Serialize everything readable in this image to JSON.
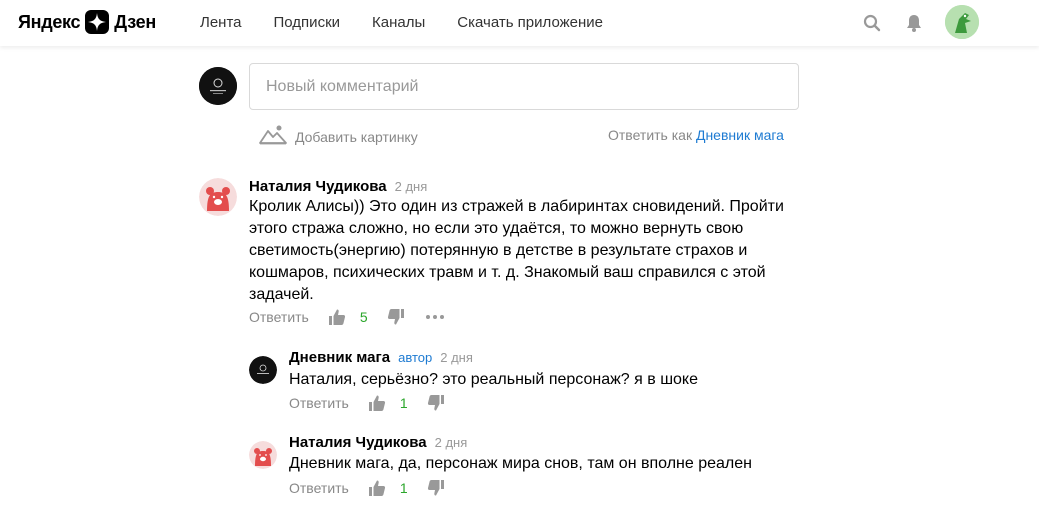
{
  "header": {
    "logo_left": "Яндекс",
    "logo_right": "Дзен",
    "nav": [
      "Лента",
      "Подписки",
      "Каналы",
      "Скачать приложение"
    ],
    "icons": [
      "search-icon",
      "bell-icon",
      "profile-avatar"
    ]
  },
  "composer": {
    "placeholder": "Новый комментарий",
    "add_picture": "Добавить картинку",
    "reply_as_prefix": "Ответить как",
    "reply_as_name": "Дневник мага"
  },
  "comments": [
    {
      "author": "Наталия Чудикова",
      "badge": "",
      "date": "2 дня",
      "text": "Кролик Алисы)) Это один из стражей в лабиринтах сновидений. Пройти этого стража сложно, но если это удаётся, то можно вернуть свою светимость(энергию) потерянную в детстве в результате страхов и кошмаров, психических травм и т. д. Знакомый ваш справился с этой задачей.",
      "reply": "Ответить",
      "likes": "5"
    },
    {
      "author": "Дневник мага",
      "badge": "автор",
      "date": "2 дня",
      "text": "Наталия, серьёзно? это реальный персонаж? я в шоке",
      "reply": "Ответить",
      "likes": "1"
    },
    {
      "author": "Наталия Чудикова",
      "badge": "",
      "date": "2 дня",
      "text": "Дневник мага, да, персонаж мира снов, там он вполне реален",
      "reply": "Ответить",
      "likes": "1"
    }
  ],
  "colors": {
    "link": "#1e7bd2",
    "like": "#2ba62b",
    "muted": "#888888",
    "bear": "#e34d4d"
  }
}
